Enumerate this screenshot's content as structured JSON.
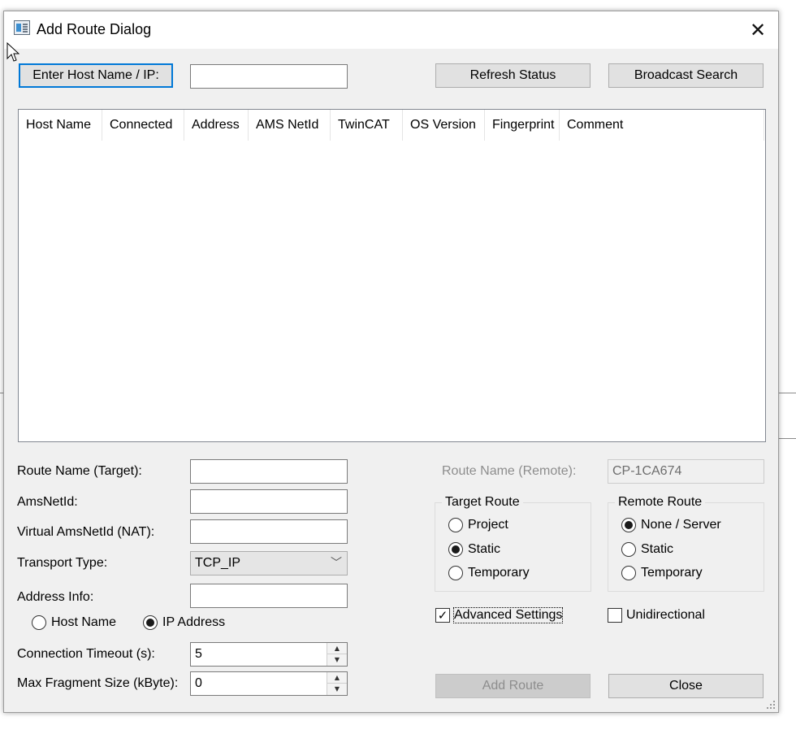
{
  "window": {
    "title": "Add Route Dialog",
    "close_glyph": "✕"
  },
  "top": {
    "enter_host_label": "Enter Host Name / IP:",
    "host_value": "",
    "refresh_label": "Refresh Status",
    "broadcast_label": "Broadcast Search"
  },
  "table": {
    "columns": [
      "Host Name",
      "Connected",
      "Address",
      "AMS NetId",
      "TwinCAT",
      "OS Version",
      "Fingerprint",
      "Comment"
    ],
    "rows": []
  },
  "form": {
    "route_name_label": "Route Name (Target):",
    "route_name_value": "",
    "amsnetid_label": "AmsNetId:",
    "amsnetid_value": "",
    "virtual_amsnetid_label": "Virtual AmsNetId (NAT):",
    "virtual_amsnetid_value": "",
    "transport_label": "Transport Type:",
    "transport_value": "TCP_IP",
    "address_info_label": "Address Info:",
    "address_info_value": "",
    "host_name_option": "Host Name",
    "ip_address_option": "IP Address",
    "address_mode_selected": "IP Address",
    "timeout_label": "Connection Timeout (s):",
    "timeout_value": "5",
    "fragment_label": "Max Fragment Size (kByte):",
    "fragment_value": "0"
  },
  "remote": {
    "route_name_remote_label": "Route Name (Remote):",
    "route_name_remote_value": "CP-1CA674"
  },
  "target_route": {
    "title": "Target Route",
    "options": [
      "Project",
      "Static",
      "Temporary"
    ],
    "selected": "Static"
  },
  "remote_route": {
    "title": "Remote Route",
    "options": [
      "None / Server",
      "Static",
      "Temporary"
    ],
    "selected": "None / Server"
  },
  "checks": {
    "advanced_label": "Advanced Settings",
    "advanced_checked": true,
    "unidirectional_label": "Unidirectional",
    "unidirectional_checked": false
  },
  "bottom": {
    "add_route_label": "Add Route",
    "close_label": "Close"
  },
  "icons": {
    "checkmark": "✓",
    "combo_arrow": "﹀",
    "spin_up": "▲",
    "spin_down": "▼"
  }
}
